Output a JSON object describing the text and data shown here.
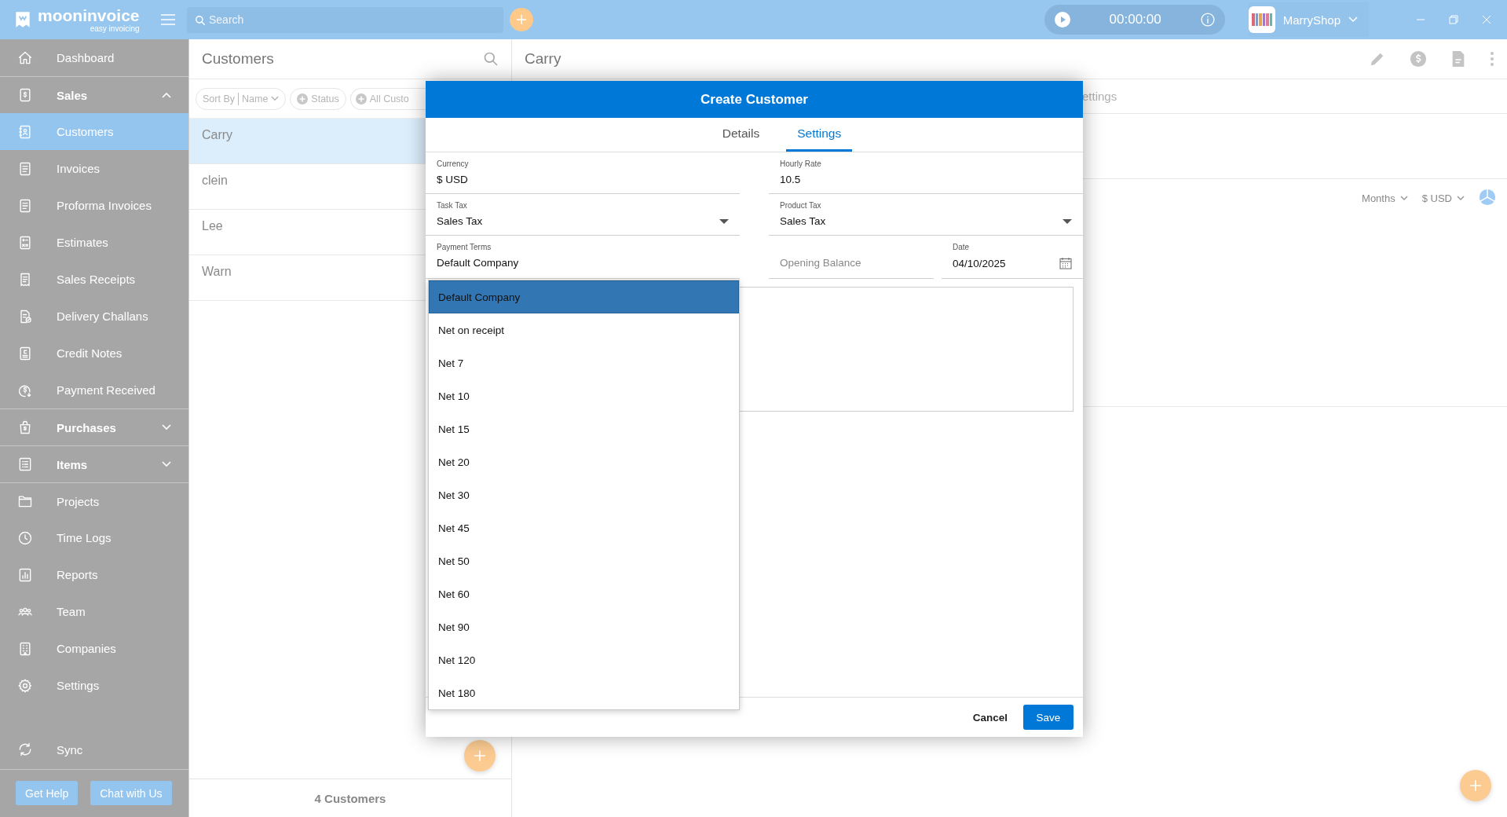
{
  "topbar": {
    "logo": "mooninvoice",
    "tagline": "easy invoicing",
    "search": {
      "placeholder": "Search"
    },
    "timer": "00:00:00",
    "shop": "MarryShop"
  },
  "sidebar": {
    "items": [
      {
        "label": "Dashboard",
        "kind": "link",
        "selected": false
      },
      {
        "label": "Sales",
        "kind": "group",
        "expanded": true,
        "selected": false,
        "children": [
          {
            "label": "Customers",
            "selected": true
          },
          {
            "label": "Invoices",
            "selected": false
          },
          {
            "label": "Proforma Invoices",
            "selected": false
          },
          {
            "label": "Estimates",
            "selected": false
          },
          {
            "label": "Sales Receipts",
            "selected": false
          },
          {
            "label": "Delivery Challans",
            "selected": false
          },
          {
            "label": "Credit Notes",
            "selected": false
          },
          {
            "label": "Payment Received",
            "selected": false
          }
        ]
      },
      {
        "label": "Purchases",
        "kind": "group",
        "expanded": false,
        "selected": false
      },
      {
        "label": "Items",
        "kind": "group",
        "expanded": false,
        "selected": false
      },
      {
        "label": "Projects",
        "kind": "link",
        "selected": false
      },
      {
        "label": "Time Logs",
        "kind": "link",
        "selected": false
      },
      {
        "label": "Reports",
        "kind": "link",
        "selected": false
      },
      {
        "label": "Team",
        "kind": "link",
        "selected": false
      },
      {
        "label": "Companies",
        "kind": "link",
        "selected": false
      },
      {
        "label": "Settings",
        "kind": "link",
        "selected": false
      }
    ],
    "sync": "Sync",
    "buttons": [
      "Get Help",
      "Chat with Us"
    ]
  },
  "customers": {
    "title": "Customers",
    "filters": [
      {
        "kind": "sort",
        "label": "Sort By",
        "value": "Name"
      },
      {
        "kind": "add",
        "label": "Status"
      },
      {
        "kind": "add",
        "label": "All Custo"
      }
    ],
    "rows": [
      {
        "name": "Carry",
        "selected": true
      },
      {
        "name": "clein",
        "selected": false
      },
      {
        "name": "Lee",
        "selected": false
      },
      {
        "name": "Warn",
        "selected": false
      }
    ],
    "count": "4 Customers"
  },
  "detail": {
    "title": "Carry",
    "tab": "ettings",
    "period": "Months",
    "currency": "$ USD"
  },
  "modal": {
    "title": "Create Customer",
    "tabs": [
      {
        "label": "Details",
        "selected": false
      },
      {
        "label": "Settings",
        "selected": true
      }
    ],
    "field_rows": [
      {
        "fields": [
          {
            "kind": "text",
            "label": "Currency",
            "value": "$ USD"
          },
          {
            "kind": "text",
            "label": "Hourly Rate",
            "value": "10.5"
          }
        ]
      },
      {
        "fields": [
          {
            "kind": "select",
            "label": "Task Tax",
            "value": "Sales Tax"
          },
          {
            "kind": "select",
            "label": "Product Tax",
            "value": "Sales Tax"
          }
        ]
      },
      {
        "fields": [
          {
            "kind": "menu",
            "label": "Payment Terms",
            "value": "Default Company",
            "open": true,
            "options": [
              {
                "label": "Default Company",
                "selected": true
              },
              {
                "label": "Net on receipt",
                "selected": false
              },
              {
                "label": "Net 7",
                "selected": false
              },
              {
                "label": "Net 10",
                "selected": false
              },
              {
                "label": "Net 15",
                "selected": false
              },
              {
                "label": "Net 20",
                "selected": false
              },
              {
                "label": "Net 30",
                "selected": false
              },
              {
                "label": "Net 45",
                "selected": false
              },
              {
                "label": "Net 50",
                "selected": false
              },
              {
                "label": "Net 60",
                "selected": false
              },
              {
                "label": "Net 90",
                "selected": false
              },
              {
                "label": "Net 120",
                "selected": false
              },
              {
                "label": "Net 180",
                "selected": false
              }
            ]
          },
          {
            "kind": "placeholder",
            "placeholder": "Opening Balance"
          },
          {
            "kind": "date",
            "label": "Date",
            "value": "04/10/2025"
          }
        ]
      }
    ],
    "cancel": "Cancel",
    "save": "Save"
  }
}
